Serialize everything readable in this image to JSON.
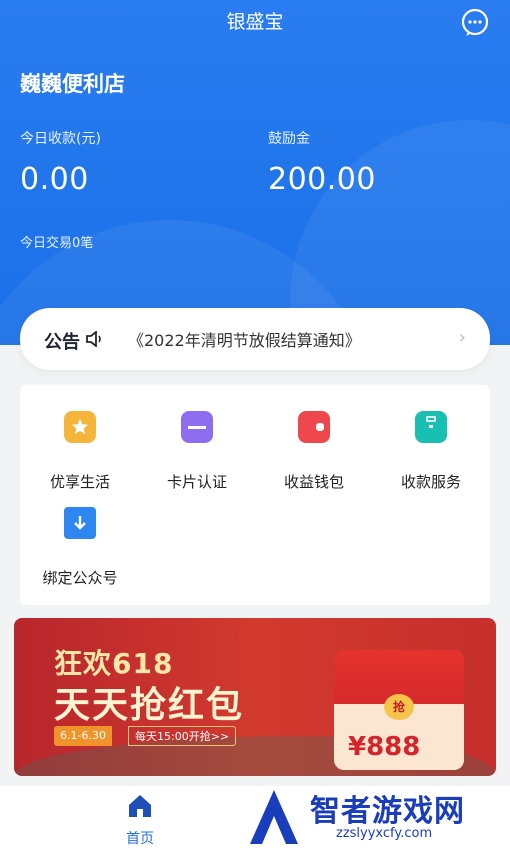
{
  "header": {
    "title": "银盛宝",
    "store_name": "巍巍便利店",
    "today_income_label": "今日收款(元)",
    "today_income_value": "0.00",
    "bonus_label": "鼓励金",
    "bonus_value": "200.00",
    "today_trades": "今日交易0笔",
    "chat_icon": "chat-bubble-icon"
  },
  "notice": {
    "logo_text": "公告",
    "icon": "speaker-icon",
    "text": "《2022年清明节放假结算通知》",
    "arrow_icon": "chevron-right-icon"
  },
  "grid": {
    "items": [
      {
        "label": "优享生活",
        "icon": "star-icon",
        "color": "#f5b53a"
      },
      {
        "label": "卡片认证",
        "icon": "card-icon",
        "color": "#8f6df0"
      },
      {
        "label": "收益钱包",
        "icon": "wallet-icon",
        "color": "#f0474e"
      },
      {
        "label": "收款服务",
        "icon": "briefcase-icon",
        "color": "#19bfb2"
      },
      {
        "label": "绑定公众号",
        "icon": "bookmark-download-icon",
        "color": "#2e86f0"
      }
    ]
  },
  "banner": {
    "line1": "狂欢618",
    "line2": "天天抢红包",
    "dates": "6.1-6.30",
    "time": "每天15:00开抢>>",
    "seal": "抢",
    "amount": "¥888"
  },
  "tabbar": {
    "home_label": "首页",
    "home_icon": "home-icon"
  },
  "watermark": {
    "title": "智者游戏网",
    "url": "zzslyyxcfy.com"
  },
  "colors": {
    "primary": "#1f6fe8",
    "header_bg": "#2a7df0"
  }
}
